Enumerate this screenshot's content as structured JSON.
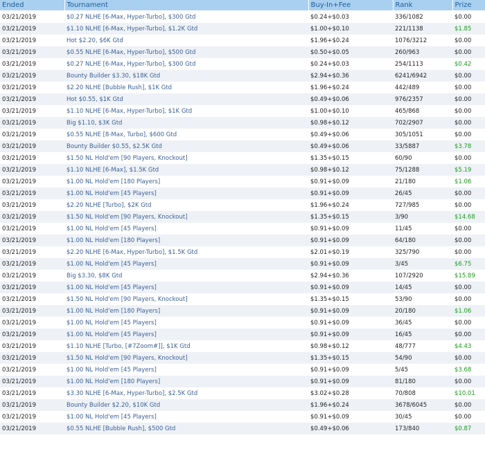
{
  "columns": {
    "ended": "Ended",
    "tournament": "Tournament",
    "buyin": "Buy-In+Fee",
    "rank": "Rank",
    "prize": "Prize"
  },
  "colors": {
    "header_bg": "#a9d0f0",
    "header_text": "#1f5c99",
    "link": "#3b5f94",
    "win": "#1a9a1a",
    "alt_row": "#eef2f7"
  },
  "rows": [
    {
      "ended": "03/21/2019",
      "tournament": "$0.27 NLHE [6-Max, Hyper-Turbo], $300 Gtd",
      "buyin": "$0.24+$0.03",
      "rank": "336/1082",
      "prize": "$0.00"
    },
    {
      "ended": "03/21/2019",
      "tournament": "$1.10 NLHE [6-Max, Hyper-Turbo], $1.2K Gtd",
      "buyin": "$1.00+$0.10",
      "rank": "221/1138",
      "prize": "$1.85"
    },
    {
      "ended": "03/21/2019",
      "tournament": "Hot $2.20, $6K Gtd",
      "buyin": "$1.96+$0.24",
      "rank": "1076/3212",
      "prize": "$0.00"
    },
    {
      "ended": "03/21/2019",
      "tournament": "$0.55 NLHE [6-Max, Hyper-Turbo], $500 Gtd",
      "buyin": "$0.50+$0.05",
      "rank": "260/963",
      "prize": "$0.00"
    },
    {
      "ended": "03/21/2019",
      "tournament": "$0.27 NLHE [6-Max, Hyper-Turbo], $300 Gtd",
      "buyin": "$0.24+$0.03",
      "rank": "254/1113",
      "prize": "$0.42"
    },
    {
      "ended": "03/21/2019",
      "tournament": "Bounty Builder $3.30, $18K Gtd",
      "buyin": "$2.94+$0.36",
      "rank": "6241/6942",
      "prize": "$0.00"
    },
    {
      "ended": "03/21/2019",
      "tournament": "$2.20 NLHE [Bubble Rush], $1K Gtd",
      "buyin": "$1.96+$0.24",
      "rank": "442/489",
      "prize": "$0.00"
    },
    {
      "ended": "03/21/2019",
      "tournament": "Hot $0.55, $1K Gtd",
      "buyin": "$0.49+$0.06",
      "rank": "976/2357",
      "prize": "$0.00"
    },
    {
      "ended": "03/21/2019",
      "tournament": "$1.10 NLHE [6-Max, Hyper-Turbo], $1K Gtd",
      "buyin": "$1.00+$0.10",
      "rank": "465/868",
      "prize": "$0.00"
    },
    {
      "ended": "03/21/2019",
      "tournament": "Big $1.10, $3K Gtd",
      "buyin": "$0.98+$0.12",
      "rank": "702/2907",
      "prize": "$0.00"
    },
    {
      "ended": "03/21/2019",
      "tournament": "$0.55 NLHE [8-Max, Turbo], $600 Gtd",
      "buyin": "$0.49+$0.06",
      "rank": "305/1051",
      "prize": "$0.00"
    },
    {
      "ended": "03/21/2019",
      "tournament": "Bounty Builder $0.55, $2.5K Gtd",
      "buyin": "$0.49+$0.06",
      "rank": "33/5887",
      "prize": "$3.78"
    },
    {
      "ended": "03/21/2019",
      "tournament": "$1.50 NL Hold'em [90 Players, Knockout]",
      "buyin": "$1.35+$0.15",
      "rank": "60/90",
      "prize": "$0.00"
    },
    {
      "ended": "03/21/2019",
      "tournament": "$1.10 NLHE [6-Max], $1.5K Gtd",
      "buyin": "$0.98+$0.12",
      "rank": "75/1288",
      "prize": "$5.19"
    },
    {
      "ended": "03/21/2019",
      "tournament": "$1.00 NL Hold'em [180 Players]",
      "buyin": "$0.91+$0.09",
      "rank": "21/180",
      "prize": "$1.06"
    },
    {
      "ended": "03/21/2019",
      "tournament": "$1.00 NL Hold'em [45 Players]",
      "buyin": "$0.91+$0.09",
      "rank": "26/45",
      "prize": "$0.00"
    },
    {
      "ended": "03/21/2019",
      "tournament": "$2.20 NLHE [Turbo], $2K Gtd",
      "buyin": "$1.96+$0.24",
      "rank": "727/985",
      "prize": "$0.00"
    },
    {
      "ended": "03/21/2019",
      "tournament": "$1.50 NL Hold'em [90 Players, Knockout]",
      "buyin": "$1.35+$0.15",
      "rank": "3/90",
      "prize": "$14.68"
    },
    {
      "ended": "03/21/2019",
      "tournament": "$1.00 NL Hold'em [45 Players]",
      "buyin": "$0.91+$0.09",
      "rank": "11/45",
      "prize": "$0.00"
    },
    {
      "ended": "03/21/2019",
      "tournament": "$1.00 NL Hold'em [180 Players]",
      "buyin": "$0.91+$0.09",
      "rank": "64/180",
      "prize": "$0.00"
    },
    {
      "ended": "03/21/2019",
      "tournament": "$2.20 NLHE [6-Max, Hyper-Turbo], $1.5K Gtd",
      "buyin": "$2.01+$0.19",
      "rank": "325/790",
      "prize": "$0.00"
    },
    {
      "ended": "03/21/2019",
      "tournament": "$1.00 NL Hold'em [45 Players]",
      "buyin": "$0.91+$0.09",
      "rank": "3/45",
      "prize": "$6.75"
    },
    {
      "ended": "03/21/2019",
      "tournament": "Big $3.30, $8K Gtd",
      "buyin": "$2.94+$0.36",
      "rank": "107/2920",
      "prize": "$15.89"
    },
    {
      "ended": "03/21/2019",
      "tournament": "$1.00 NL Hold'em [45 Players]",
      "buyin": "$0.91+$0.09",
      "rank": "14/45",
      "prize": "$0.00"
    },
    {
      "ended": "03/21/2019",
      "tournament": "$1.50 NL Hold'em [90 Players, Knockout]",
      "buyin": "$1.35+$0.15",
      "rank": "53/90",
      "prize": "$0.00"
    },
    {
      "ended": "03/21/2019",
      "tournament": "$1.00 NL Hold'em [180 Players]",
      "buyin": "$0.91+$0.09",
      "rank": "20/180",
      "prize": "$1.06"
    },
    {
      "ended": "03/21/2019",
      "tournament": "$1.00 NL Hold'em [45 Players]",
      "buyin": "$0.91+$0.09",
      "rank": "36/45",
      "prize": "$0.00"
    },
    {
      "ended": "03/21/2019",
      "tournament": "$1.00 NL Hold'em [45 Players]",
      "buyin": "$0.91+$0.09",
      "rank": "16/45",
      "prize": "$0.00"
    },
    {
      "ended": "03/21/2019",
      "tournament": "$1.10 NLHE [Turbo, [#7Zoom#]], $1K Gtd",
      "buyin": "$0.98+$0.12",
      "rank": "48/777",
      "prize": "$4.43"
    },
    {
      "ended": "03/21/2019",
      "tournament": "$1.50 NL Hold'em [90 Players, Knockout]",
      "buyin": "$1.35+$0.15",
      "rank": "54/90",
      "prize": "$0.00"
    },
    {
      "ended": "03/21/2019",
      "tournament": "$1.00 NL Hold'em [45 Players]",
      "buyin": "$0.91+$0.09",
      "rank": "5/45",
      "prize": "$3.68"
    },
    {
      "ended": "03/21/2019",
      "tournament": "$1.00 NL Hold'em [180 Players]",
      "buyin": "$0.91+$0.09",
      "rank": "81/180",
      "prize": "$0.00"
    },
    {
      "ended": "03/21/2019",
      "tournament": "$3.30 NLHE [6-Max, Hyper-Turbo], $2.5K Gtd",
      "buyin": "$3.02+$0.28",
      "rank": "70/808",
      "prize": "$10.01"
    },
    {
      "ended": "03/21/2019",
      "tournament": "Bounty Builder $2.20, $10K Gtd",
      "buyin": "$1.96+$0.24",
      "rank": "3678/6045",
      "prize": "$0.00"
    },
    {
      "ended": "03/21/2019",
      "tournament": "$1.00 NL Hold'em [45 Players]",
      "buyin": "$0.91+$0.09",
      "rank": "30/45",
      "prize": "$0.00"
    },
    {
      "ended": "03/21/2019",
      "tournament": "$0.55 NLHE [Bubble Rush], $500 Gtd",
      "buyin": "$0.49+$0.06",
      "rank": "173/840",
      "prize": "$0.87"
    }
  ]
}
